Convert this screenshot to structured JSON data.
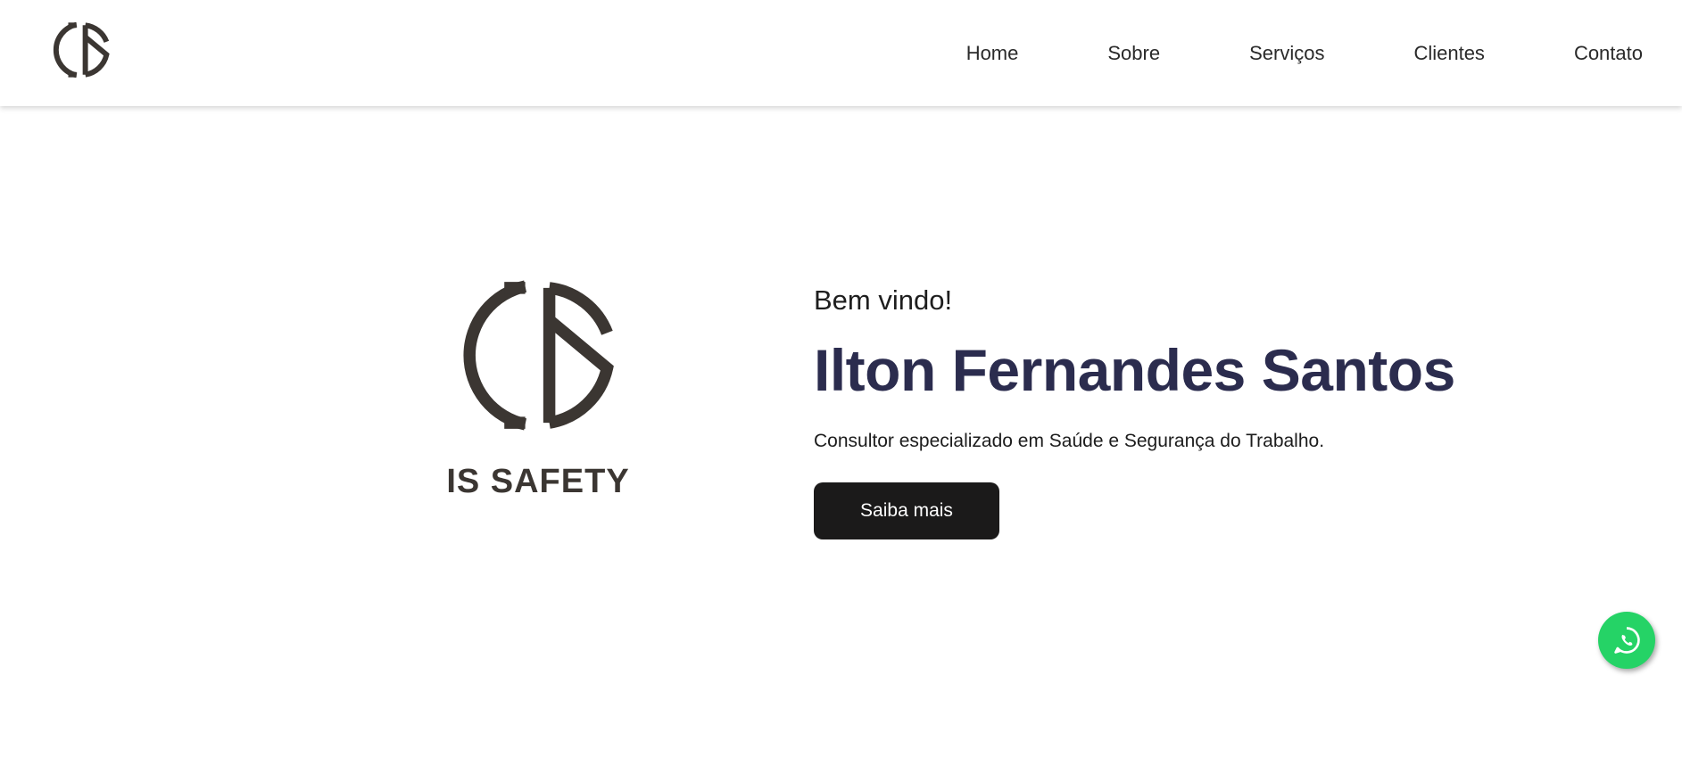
{
  "header": {
    "logo_icon": "is-monogram-logo",
    "nav": [
      {
        "label": "Home"
      },
      {
        "label": "Sobre"
      },
      {
        "label": "Serviços"
      },
      {
        "label": "Clientes"
      },
      {
        "label": "Contato"
      }
    ]
  },
  "hero": {
    "logo_brand": "IS SAFETY",
    "greeting": "Bem vindo!",
    "name": "Ilton Fernandes Santos",
    "tagline": "Consultor especializado em Saúde e Segurança do Trabalho.",
    "cta_label": "Saiba mais"
  },
  "floating": {
    "whatsapp_icon": "whatsapp-icon"
  },
  "colors": {
    "logo": "#3b3632",
    "name_text": "#2b2c4e",
    "cta_bg": "#1b1a1a",
    "whatsapp": "#25d366"
  }
}
